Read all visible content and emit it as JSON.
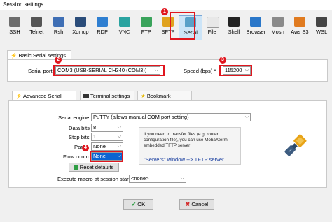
{
  "window": {
    "title": "Session settings"
  },
  "toolbar": {
    "items": [
      {
        "label": "SSH",
        "icon": "ssh-icon",
        "color": "#6d6d6d"
      },
      {
        "label": "Telnet",
        "icon": "telnet-icon",
        "color": "#555555"
      },
      {
        "label": "Rsh",
        "icon": "rsh-icon",
        "color": "#3f6fb5"
      },
      {
        "label": "Xdmcp",
        "icon": "xdmcp-icon",
        "color": "#2b4d7a"
      },
      {
        "label": "RDP",
        "icon": "rdp-icon",
        "color": "#2f7fd1"
      },
      {
        "label": "VNC",
        "icon": "vnc-icon",
        "color": "#2aa3a0"
      },
      {
        "label": "FTP",
        "icon": "ftp-icon",
        "color": "#3aa35b"
      },
      {
        "label": "SFTP",
        "icon": "sftp-icon",
        "color": "#e0a21e"
      },
      {
        "label": "Serial",
        "icon": "serial-icon",
        "color": "#5aa0c8",
        "selected": true
      },
      {
        "label": "File",
        "icon": "file-icon",
        "color": "#e8e8e8"
      },
      {
        "label": "Shell",
        "icon": "shell-icon",
        "color": "#222222"
      },
      {
        "label": "Browser",
        "icon": "browser-icon",
        "color": "#2a77c9"
      },
      {
        "label": "Mosh",
        "icon": "mosh-icon",
        "color": "#8a8a8a"
      },
      {
        "label": "Aws S3",
        "icon": "aws-s3-icon",
        "color": "#e07b20"
      },
      {
        "label": "WSL",
        "icon": "wsl-icon",
        "color": "#444444"
      }
    ]
  },
  "basic": {
    "tab_label": "Basic Serial settings",
    "serial_port_label": "Serial port *",
    "serial_port_value": "COM3  (USB-SERIAL CH340 (COM3))",
    "speed_label": "Speed (bps) *",
    "speed_value": "115200"
  },
  "advanced_tabs": [
    "Advanced Serial settings",
    "Terminal settings",
    "Bookmark settings"
  ],
  "advanced": {
    "serial_engine_label": "Serial engine:",
    "serial_engine_value": "PuTTY    (allows manual COM port setting)",
    "data_bits_label": "Data bits",
    "data_bits_value": "8",
    "stop_bits_label": "Stop bits",
    "stop_bits_value": "1",
    "parity_label": "Parity",
    "parity_value": "None",
    "flow_control_label": "Flow control",
    "flow_control_value": "None",
    "reset_button": "Reset defaults",
    "info_text": "If you need to transfer files (e.g. router configuration file), you can use MobaXterm embedded TFTP server",
    "servers_hint": "\"Servers\" window  -->  TFTP server",
    "macro_label": "Execute macro at session start:",
    "macro_value": "<none>"
  },
  "annotations": [
    "1",
    "2",
    "3",
    "4"
  ],
  "footer": {
    "ok": "OK",
    "cancel": "Cancel"
  }
}
